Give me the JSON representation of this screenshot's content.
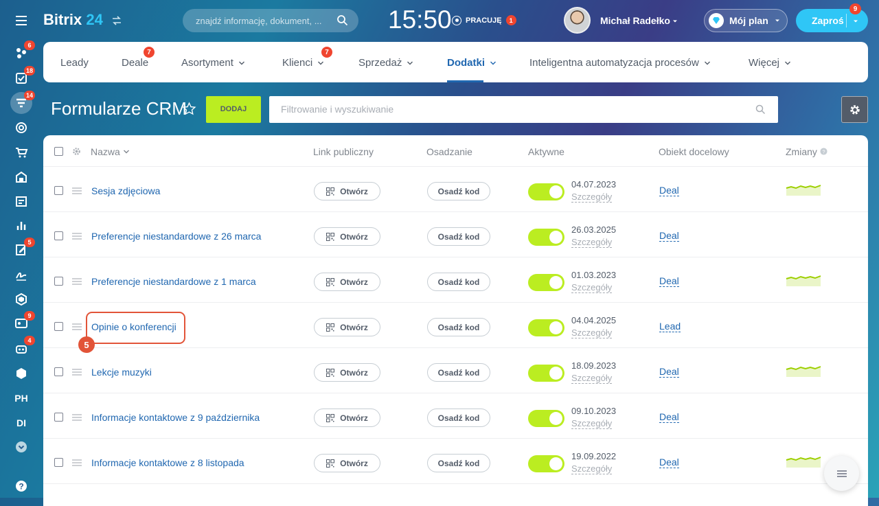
{
  "sidebar": {
    "badges": {
      "activity": "6",
      "tasks": "18",
      "crm": "14",
      "feed": "5",
      "contacts": "9",
      "robots": "4"
    },
    "text_items": [
      "PH",
      "DI"
    ]
  },
  "header": {
    "logo_text": "Bitrix",
    "logo_number": "24",
    "search_placeholder": "znajdź informację, dokument, ...",
    "clock": "15:50",
    "work_status": "PRACUJĘ",
    "work_badge": "1",
    "user_name": "Michał Radełko",
    "plan_label": "Mój plan",
    "invite_label": "Zaproś",
    "invite_badge": "9"
  },
  "tabs": {
    "items": [
      {
        "label": "Leady"
      },
      {
        "label": "Deale",
        "badge": "7"
      },
      {
        "label": "Asortyment"
      },
      {
        "label": "Klienci",
        "badge": "7"
      },
      {
        "label": "Sprzedaż"
      },
      {
        "label": "Dodatki",
        "active": true
      },
      {
        "label": "Inteligentna automatyzacja procesów"
      },
      {
        "label": "Więcej"
      }
    ]
  },
  "page": {
    "title": "Formularze CRM",
    "add_button": "DODAJ",
    "filter_placeholder": "Filtrowanie i wyszukiwanie"
  },
  "grid": {
    "columns": {
      "name": "Nazwa",
      "link": "Link publiczny",
      "embed": "Osadzanie",
      "active": "Aktywne",
      "target": "Obiekt docelowy",
      "changes": "Zmiany"
    },
    "open_label": "Otwórz",
    "embed_label": "Osadź kod",
    "details_label": "Szczegóły",
    "rows": [
      {
        "name": "Sesja zdjęciowa",
        "date": "04.07.2023",
        "target": "Deal",
        "chart": true
      },
      {
        "name": "Preferencje niestandardowe z 26 marca",
        "date": "26.03.2025",
        "target": "Deal",
        "chart": false
      },
      {
        "name": "Preferencje niestandardowe z 1 marca",
        "date": "01.03.2023",
        "target": "Deal",
        "chart": true
      },
      {
        "name": "Opinie o konferencji",
        "date": "04.04.2025",
        "target": "Lead",
        "chart": false
      },
      {
        "name": "Lekcje muzyki",
        "date": "18.09.2023",
        "target": "Deal",
        "chart": true
      },
      {
        "name": "Informacje kontaktowe z 9 października",
        "date": "09.10.2023",
        "target": "Deal",
        "chart": false
      },
      {
        "name": "Informacje kontaktowe z 8 listopada",
        "date": "19.09.2022",
        "target": "Deal",
        "chart": true
      }
    ]
  },
  "annotation": {
    "step": "5"
  },
  "colors": {
    "accent_green": "#bbed21",
    "link_blue": "#2067b0",
    "badge_red": "#f0452f",
    "highlight_red": "#e25438"
  }
}
